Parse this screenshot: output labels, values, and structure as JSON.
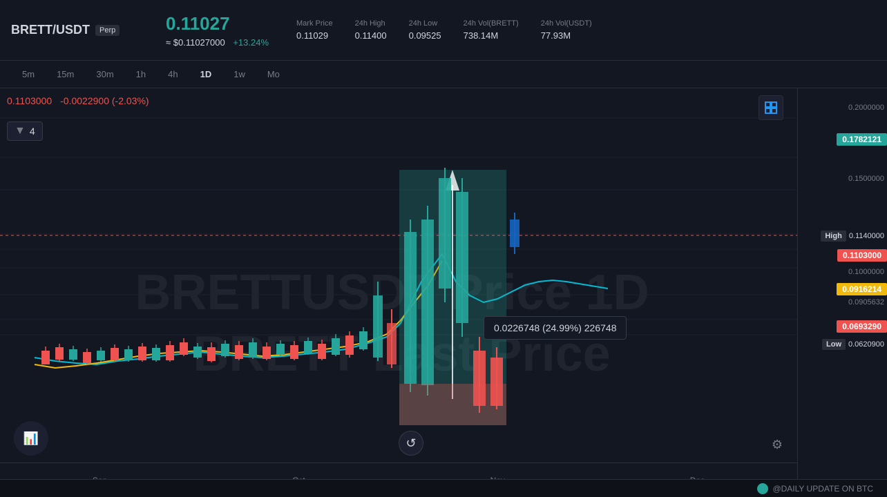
{
  "header": {
    "symbol": "BRETT/USDT",
    "type": "Perp",
    "main_price": "0.11027",
    "usd_price": "≈ $0.11027000",
    "change": "+13.24%",
    "stats": [
      {
        "label": "Mark Price",
        "value": "0.11029"
      },
      {
        "label": "24h High",
        "value": "0.11400"
      },
      {
        "label": "24h Low",
        "value": "0.09525"
      },
      {
        "label": "24h Vol(BRETT)",
        "value": "738.14M"
      },
      {
        "label": "24h Vol(USDT)",
        "value": "77.93M"
      }
    ]
  },
  "timeframes": [
    "5m",
    "15m",
    "30m",
    "1h",
    "4h",
    "1D",
    "1w",
    "Mo"
  ],
  "active_timeframe": "1D",
  "chart": {
    "ohlc_price": "0.1103000",
    "ohlc_change": "-0.0022900 (-2.03%)",
    "indicator_label": "4",
    "tooltip": "0.0226748 (24.99%) 226748",
    "watermark_line1": "BRETTUSDT Price 1D",
    "watermark_line2": "BRETT Last Price"
  },
  "price_levels": [
    {
      "value": "0.2000000",
      "type": "plain",
      "top_pct": 8
    },
    {
      "value": "0.1782121",
      "type": "green",
      "top_pct": 16
    },
    {
      "value": "0.1500000",
      "type": "plain",
      "top_pct": 27
    },
    {
      "value": "0.1140000",
      "type": "plain_label",
      "label": "High",
      "top_pct": 39
    },
    {
      "value": "0.1103000",
      "type": "red",
      "top_pct": 43
    },
    {
      "value": "0.1000000",
      "type": "plain",
      "top_pct": 48
    },
    {
      "value": "0.0916214",
      "type": "yellow",
      "top_pct": 52
    },
    {
      "value": "0.0905632",
      "type": "plain",
      "top_pct": 55
    },
    {
      "value": "0.0693290",
      "type": "red_plain",
      "top_pct": 62
    },
    {
      "value": "0.0620900",
      "type": "plain_label",
      "label": "Low",
      "top_pct": 66
    }
  ],
  "time_labels": [
    "Sep",
    "Oct",
    "Nov",
    "Dec"
  ],
  "bottom_banner": {
    "icon": "⬡",
    "text": "@DAILY UPDATE ON BTC"
  },
  "buttons": {
    "expand_icon": "⊡",
    "reset_icon": "↺",
    "settings_icon": "⚙"
  }
}
